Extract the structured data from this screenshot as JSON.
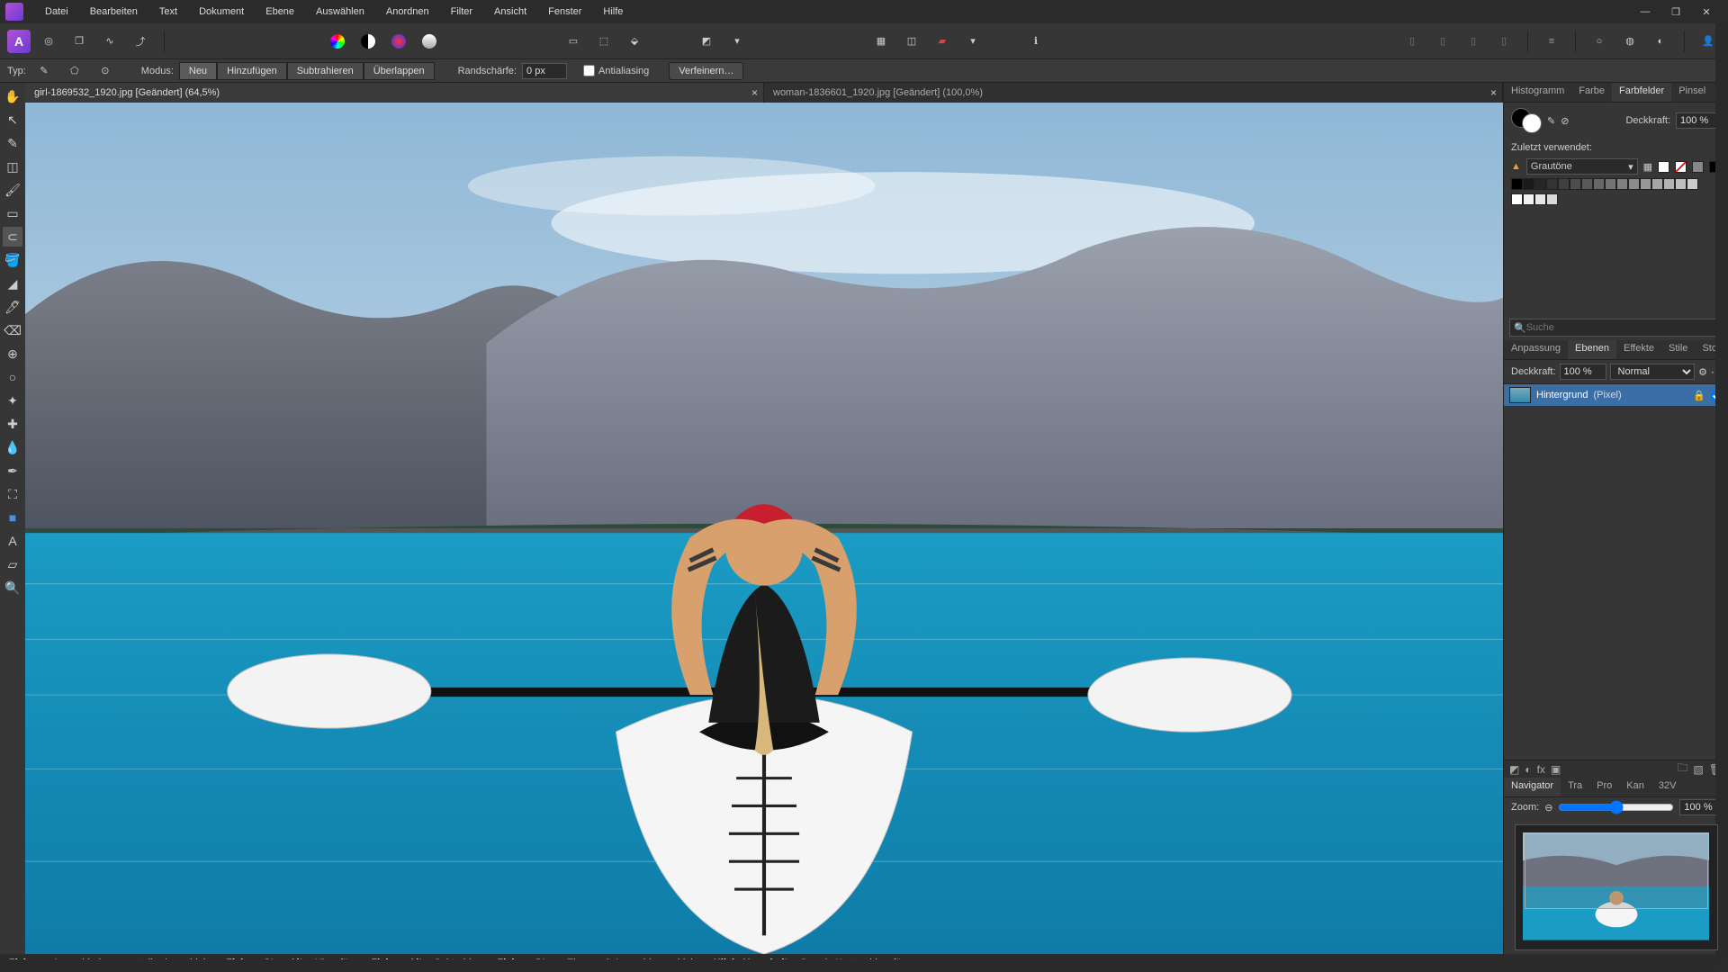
{
  "app": {
    "logo_letter": "A"
  },
  "menu": [
    "Datei",
    "Bearbeiten",
    "Text",
    "Dokument",
    "Ebene",
    "Auswählen",
    "Anordnen",
    "Filter",
    "Ansicht",
    "Fenster",
    "Hilfe"
  ],
  "window_controls": {
    "min": "—",
    "max": "❐",
    "close": "✕"
  },
  "context": {
    "type_label": "Typ:",
    "mode_label": "Modus:",
    "modes": [
      "Neu",
      "Hinzufügen",
      "Subtrahieren",
      "Überlappen"
    ],
    "feather_label": "Randschärfe:",
    "feather_value": "0 px",
    "antialias": "Antialiasing",
    "refine": "Verfeinern…"
  },
  "docs": [
    {
      "title": "girl-1869532_1920.jpg [Geändert] (64,5%)",
      "active": true
    },
    {
      "title": "woman-1836601_1920.jpg [Geändert] (100,0%)",
      "active": false
    }
  ],
  "panels": {
    "color_tabs": [
      "Histogramm",
      "Farbe",
      "Farbfelder",
      "Pinsel"
    ],
    "color_active": 2,
    "opacity_label": "Deckkraft:",
    "opacity_value": "100 %",
    "recent_label": "Zuletzt verwendet:",
    "palette_name": "Grautöne",
    "search_placeholder": "Suche",
    "layer_tabs": [
      "Anpassung",
      "Ebenen",
      "Effekte",
      "Stile",
      "Stock"
    ],
    "layer_active": 1,
    "layer_opacity_label": "Deckkraft:",
    "layer_opacity_value": "100 %",
    "blend_mode": "Normal",
    "layer_name": "Hintergrund",
    "layer_type": "(Pixel)",
    "nav_tabs": [
      "Navigator",
      "Tra",
      "Pro",
      "Kan",
      "32V"
    ],
    "nav_active": 0,
    "zoom_label": "Zoom:",
    "zoom_value": "100 %"
  },
  "swatches_gray": [
    "#000000",
    "#1a1a1a",
    "#262626",
    "#333333",
    "#404040",
    "#4d4d4d",
    "#595959",
    "#666666",
    "#737373",
    "#808080",
    "#8c8c8c",
    "#999999",
    "#a6a6a6",
    "#b3b3b3",
    "#bfbfbf",
    "#cccccc"
  ],
  "swatches_white": [
    "#ffffff",
    "#f2f2f2",
    "#e6e6e6",
    "#d9d9d9"
  ],
  "status": {
    "s1b": "Ziehen",
    "s1": " = Auswahlrahmen erstellen/verschieben. ",
    "s2b": "Ziehen+Strg+Alt",
    "s2": " = Hinzufügen. ",
    "s3b": "Ziehen+Alt",
    "s3": " = Subtrahieren. ",
    "s4b": "Ziehen+Strg",
    "s4": " = Ebene mit Auswahl verschieben. ",
    "s5b": "Klick+Umschalt",
    "s5": " = Gerade Kanten hinzufügen."
  }
}
